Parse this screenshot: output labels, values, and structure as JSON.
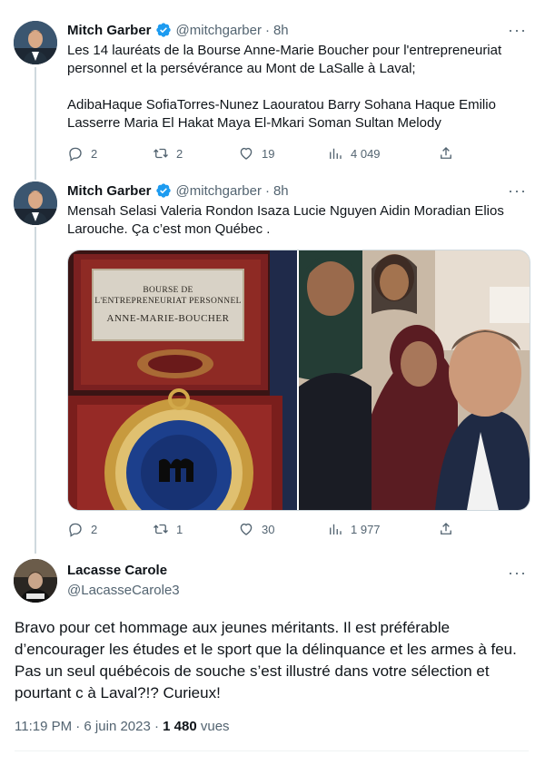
{
  "tweet1": {
    "author_name": "Mitch Garber",
    "handle": "@mitchgarber",
    "separator": "·",
    "time": "8h",
    "text": "Les 14 lauréats de la Bourse Anne-Marie Boucher pour l'entrepreneuriat personnel et la persévérance au Mont de LaSalle à Laval;\n\nAdibaHaque SofiaTorres-Nunez Laouratou Barry Sohana Haque Emilio Lasserre Maria El Hakat Maya El-Mkari Soman Sultan Melody",
    "replies": "2",
    "retweets": "2",
    "likes": "19",
    "views": "4 049"
  },
  "tweet2": {
    "author_name": "Mitch Garber",
    "handle": "@mitchgarber",
    "separator": "·",
    "time": "8h",
    "text": "Mensah Selasi Valeria Rondon Isaza Lucie Nguyen Aidin Moradian Elios Larouche. Ça c’est mon Québec .",
    "plaque_line1": "BOURSE DE",
    "plaque_line2": "L'ENTREPRENEURIAT PERSONNEL",
    "plaque_line3": "ANNE-MARIE-BOUCHER",
    "replies": "2",
    "retweets": "1",
    "likes": "30",
    "views": "1 977"
  },
  "reply": {
    "author_name": "Lacasse Carole",
    "handle": "@LacasseCarole3",
    "text": "Bravo pour cet hommage aux jeunes méritants. Il est préférable d’encourager les études et le sport que la délinquance et les armes à feu. Pas un seul québécois de souche s’est illustré dans votre sélection et pourtant c à Laval?!? Curieux!",
    "timestamp": "11:19 PM · 6 juin 2023 · ",
    "views_count": "1 480",
    "views_label": " vues"
  },
  "icons": {
    "verified": "verified-badge-icon",
    "more": "more-dots-icon",
    "reply": "reply-icon",
    "retweet": "retweet-icon",
    "like": "heart-icon",
    "views": "views-bar-chart-icon",
    "share": "share-icon"
  },
  "colors": {
    "verified_blue": "#1d9bf0",
    "text_primary": "#0f1419",
    "text_secondary": "#536471",
    "thread_line": "#cfd9de"
  }
}
